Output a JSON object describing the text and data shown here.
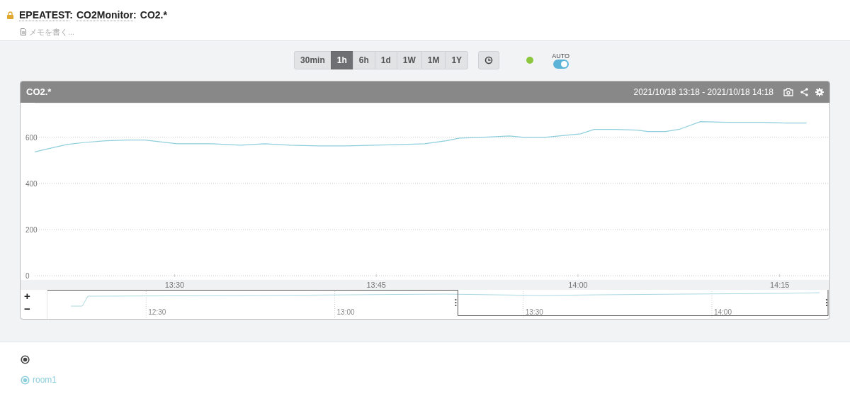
{
  "header": {
    "locked": true,
    "breadcrumbs": [
      {
        "label": "EPEATEST",
        "kind": "link",
        "separator": ":"
      },
      {
        "label": "CO2Monitor",
        "kind": "link",
        "separator": ":"
      },
      {
        "label": "CO2.*",
        "kind": "text"
      }
    ],
    "memo": {
      "placeholder": "メモを書く..."
    }
  },
  "toolbar": {
    "ranges": [
      {
        "label": "30min",
        "selected": false
      },
      {
        "label": "1h",
        "selected": true
      },
      {
        "label": "6h",
        "selected": false
      },
      {
        "label": "1d",
        "selected": false
      },
      {
        "label": "1W",
        "selected": false
      },
      {
        "label": "1M",
        "selected": false
      },
      {
        "label": "1Y",
        "selected": false
      }
    ],
    "status": {
      "color": "#8cc63f"
    },
    "auto": {
      "label": "AUTO",
      "on": true
    }
  },
  "panel": {
    "title": "CO2.*",
    "range_text": "2021/10/18 13:18 - 2021/10/18 14:18",
    "chart_data": {
      "type": "line",
      "grid": true,
      "x": [
        799.6,
        800.2,
        802.0,
        803.3,
        804.9,
        806.5,
        807.8,
        810.2,
        812.8,
        814.9,
        816.7,
        818.6,
        820.7,
        822.8,
        824.9,
        827.0,
        828.6,
        830.2,
        831.2,
        832.8,
        834.9,
        836.0,
        837.5,
        840.2,
        841.2,
        842.8,
        844.4,
        845.2,
        846.5,
        847.5,
        849.1,
        851.2,
        853.8,
        855.4,
        857.0
      ],
      "series": [
        {
          "name": "room1",
          "color": "#8ecfdc",
          "values": [
            537,
            545,
            569,
            578,
            585,
            588,
            588,
            572,
            572,
            566,
            572,
            566,
            563,
            563,
            566,
            569,
            572,
            585,
            597,
            600,
            606,
            600,
            600,
            615,
            634,
            634,
            631,
            625,
            625,
            634,
            668,
            665,
            665,
            662,
            662
          ]
        }
      ],
      "xlim": [
        799.6,
        858.6
      ],
      "ylim": [
        0,
        750
      ],
      "xticks": [
        {
          "value": 810,
          "label": "13:30"
        },
        {
          "value": 825,
          "label": "13:45"
        },
        {
          "value": 840,
          "label": "14:00"
        },
        {
          "value": 855,
          "label": "14:15"
        }
      ],
      "yticks": [
        0,
        200,
        400,
        600
      ]
    },
    "navigator": {
      "zoom_in": "+",
      "zoom_out": "−",
      "ticks": [
        "12:30",
        "13:00",
        "13:30",
        "14:00"
      ]
    }
  },
  "legend": {
    "all_selected": true,
    "items": [
      {
        "selected": true
      }
    ]
  }
}
